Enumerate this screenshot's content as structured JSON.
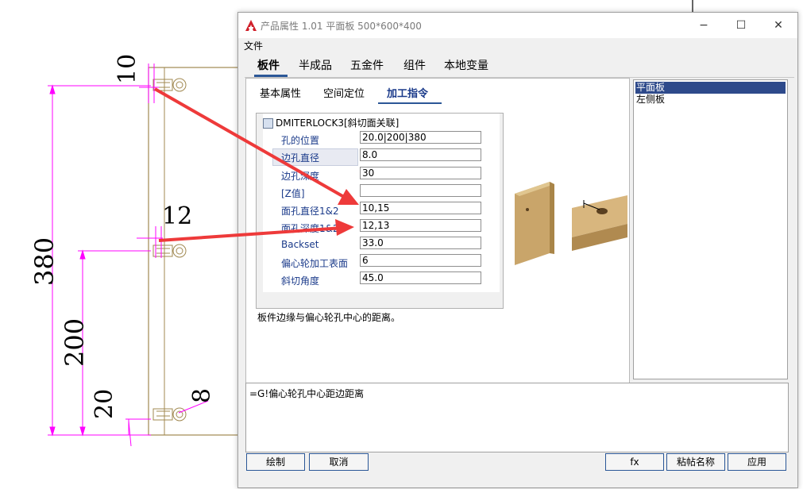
{
  "window": {
    "title": "产品属性 1.01 平面板 500*600*400",
    "menu_file": "文件",
    "minimize_icon": "−",
    "maximize_icon": "☐",
    "close_icon": "✕"
  },
  "top_tabs": [
    "板件",
    "半成品",
    "五金件",
    "组件",
    "本地变量"
  ],
  "sub_tabs": [
    "基本属性",
    "空间定位",
    "加工指令"
  ],
  "grid": {
    "title": "DMITERLOCK3[斜切面关联]",
    "rows": [
      {
        "label": "孔的位置",
        "value": "20.0|200|380"
      },
      {
        "label": "边孔直径",
        "value": "8.0"
      },
      {
        "label": "边孔深度",
        "value": "30"
      },
      {
        "label": "[Z值]",
        "value": ""
      },
      {
        "label": "面孔直径1&2",
        "value": "10,15"
      },
      {
        "label": "面孔深度1&2",
        "value": "12,13"
      },
      {
        "label": "Backset",
        "value": "33.0"
      },
      {
        "label": "偏心轮加工表面",
        "value": "6"
      },
      {
        "label": "斜切角度",
        "value": "45.0"
      }
    ]
  },
  "hint": "板件边缘与偏心轮孔中心的距离。",
  "parts_list": [
    "平面板",
    "左侧板"
  ],
  "formula": "=G!偏心轮孔中心距边距离",
  "buttons": {
    "draw": "绘制",
    "cancel": "取消",
    "fx": "fx",
    "paste_name": "粘帖名称",
    "apply": "应用"
  },
  "cad": {
    "dim_10": "10",
    "dim_12": "12",
    "dim_380": "380",
    "dim_200": "200",
    "dim_20": "20",
    "dim_8": "8"
  },
  "colors": {
    "dimension": "#ff00ff",
    "panel_outline": "#a08850",
    "arrow": "#ee3a3a",
    "accent": "#2b5797"
  }
}
